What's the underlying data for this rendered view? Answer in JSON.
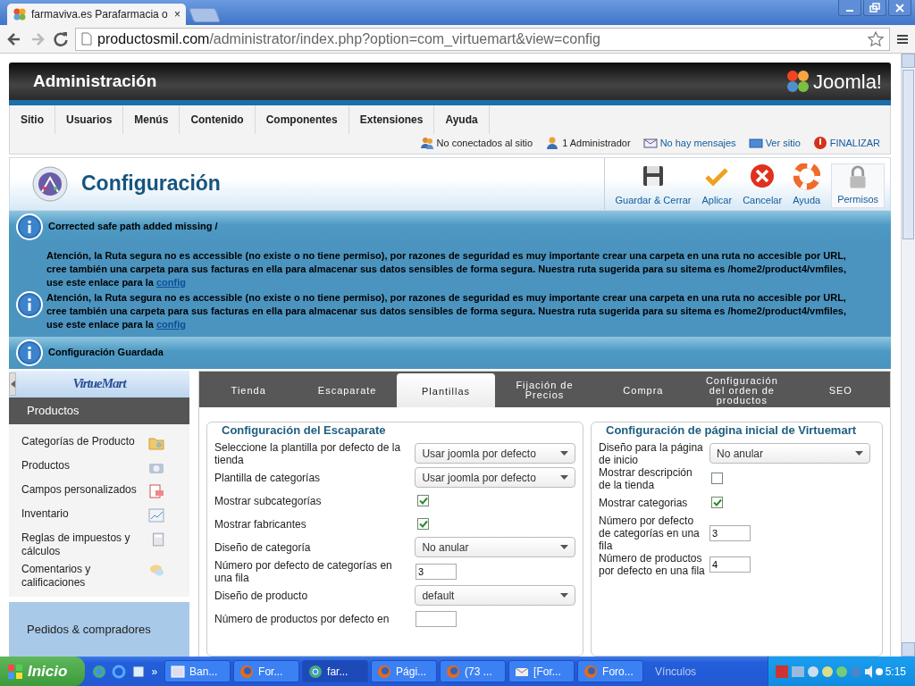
{
  "browser": {
    "tabs": [
      {
        "title": "farmaviva.es Parafarmacia o",
        "selected": true,
        "close": "×"
      }
    ],
    "url_host": "productosmil.com",
    "url_path": "/administrator/index.php?option=com_virtuemart&view=config"
  },
  "header": {
    "title": "Administración",
    "logo_text": "Joomla!"
  },
  "menu": [
    "Sitio",
    "Usuarios",
    "Menús",
    "Contenido",
    "Componentes",
    "Extensiones",
    "Ayuda"
  ],
  "status": [
    {
      "kind": "users",
      "text": "No conectados al sitio",
      "link": false
    },
    {
      "kind": "user",
      "text": "1 Administrador",
      "link": false
    },
    {
      "kind": "mail",
      "text": "No hay mensajes",
      "link": true
    },
    {
      "kind": "screen",
      "text": "Ver sitio",
      "link": true
    },
    {
      "kind": "power",
      "text": "FINALIZAR",
      "link": true
    }
  ],
  "toolbar": {
    "title": "Configuración",
    "buttons": [
      {
        "kind": "save",
        "label": "Guardar & Cerrar"
      },
      {
        "kind": "apply",
        "label": "Aplicar"
      },
      {
        "kind": "cancel",
        "label": "Cancelar"
      },
      {
        "kind": "help",
        "label": "Ayuda"
      },
      {
        "kind": "lock",
        "label": "Permisos"
      }
    ]
  },
  "messages": [
    {
      "kind": "info",
      "text": "Corrected safe path added missing /"
    },
    {
      "kind": "warning",
      "text": "Atención, la Ruta segura no es accessible (no existe o no tiene permiso), por razones de seguridad es muy importante crear una carpeta en una ruta no accesible por URL, cree también una carpeta para sus facturas en ella para almacenar sus datos sensibles de forma segura. Nuestra ruta sugerida para su sitema es /home2/product4/vmfiles, use este enlace para la",
      "link": "config"
    },
    {
      "kind": "warning",
      "text": "Atención, la Ruta segura no es accessible (no existe o no tiene permiso), por razones de seguridad es muy importante crear una carpeta en una ruta no accesible por URL, cree también una carpeta para sus facturas en ella para almacenar sus datos sensibles de forma segura. Nuestra ruta sugerida para su sitema es /home2/product4/vmfiles, use este enlace para la",
      "link": "config"
    },
    {
      "kind": "info",
      "text": "Configuración Guardada"
    }
  ],
  "sidebar": {
    "logo": "VirtueMart",
    "sections": [
      {
        "title": "Productos",
        "expanded": true,
        "items": [
          {
            "kind": "folder",
            "label": "Categorías de Producto"
          },
          {
            "kind": "camera",
            "label": "Productos"
          },
          {
            "kind": "form",
            "label": "Campos personalizados"
          },
          {
            "kind": "chart",
            "label": "Inventario"
          },
          {
            "kind": "calculator",
            "label": "Reglas de impuestos y cálculos"
          },
          {
            "kind": "comments",
            "label": "Comentarios y calificaciones"
          }
        ]
      },
      {
        "title": "Pedidos & compradores",
        "expanded": false
      }
    ]
  },
  "tabs": [
    {
      "label": "Tienda",
      "selected": false
    },
    {
      "label": "Escaparate",
      "selected": false
    },
    {
      "label": "Plantillas",
      "selected": true
    },
    {
      "label": "Fijación de Precios",
      "selected": false
    },
    {
      "label": "Compra",
      "selected": false
    },
    {
      "label": "Configuración del orden de productos",
      "selected": false
    },
    {
      "label": "SEO",
      "selected": false
    }
  ],
  "panels": [
    {
      "title": "Configuración del Escaparate",
      "fields": [
        {
          "kind": "select",
          "label": "Seleccione la plantilla por defecto de la tienda",
          "value": "Usar joomla por defecto"
        },
        {
          "kind": "select",
          "label": "Plantilla de categorías",
          "value": "Usar joomla por defecto"
        },
        {
          "kind": "checkbox",
          "label": "Mostrar subcategorías",
          "checked": true
        },
        {
          "kind": "checkbox",
          "label": "Mostrar fabricantes",
          "checked": true
        },
        {
          "kind": "select",
          "label": "Diseño de categoría",
          "value": "No anular"
        },
        {
          "kind": "text",
          "label": "Número por defecto de categorías en una fila",
          "value": "3"
        },
        {
          "kind": "select",
          "label": "Diseño de producto",
          "value": "default"
        },
        {
          "kind": "text",
          "label": "Número de productos por defecto en"
        }
      ]
    },
    {
      "title": "Configuración de página inicial de Virtuemart",
      "fields": [
        {
          "kind": "select",
          "label": "Diseño para la página de inicio",
          "value": "No anular"
        },
        {
          "kind": "checkbox",
          "label": "Mostrar descripción de la tienda",
          "checked": false
        },
        {
          "kind": "checkbox",
          "label": "Mostrar categorias",
          "checked": true
        },
        {
          "kind": "text",
          "label": "Número por defecto de categorías en una fila",
          "value": "3"
        },
        {
          "kind": "text",
          "label": "Número de productos por defecto en una fila",
          "value": "4"
        }
      ]
    }
  ],
  "taskbar": {
    "start": "Inicio",
    "more": "»",
    "tasks": [
      {
        "kind": "window",
        "label": "Ban...",
        "selected": false
      },
      {
        "kind": "firefox",
        "label": "For...",
        "selected": false
      },
      {
        "kind": "chrome",
        "label": "far...",
        "selected": true
      },
      {
        "kind": "firefox",
        "label": "Pági...",
        "selected": false
      },
      {
        "kind": "firefox",
        "label": "(73 ...",
        "selected": false
      },
      {
        "kind": "mail",
        "label": "[For...",
        "selected": false
      },
      {
        "kind": "firefox",
        "label": "Foro...",
        "selected": false
      }
    ],
    "links": "Vínculos",
    "clock": "5:15"
  }
}
